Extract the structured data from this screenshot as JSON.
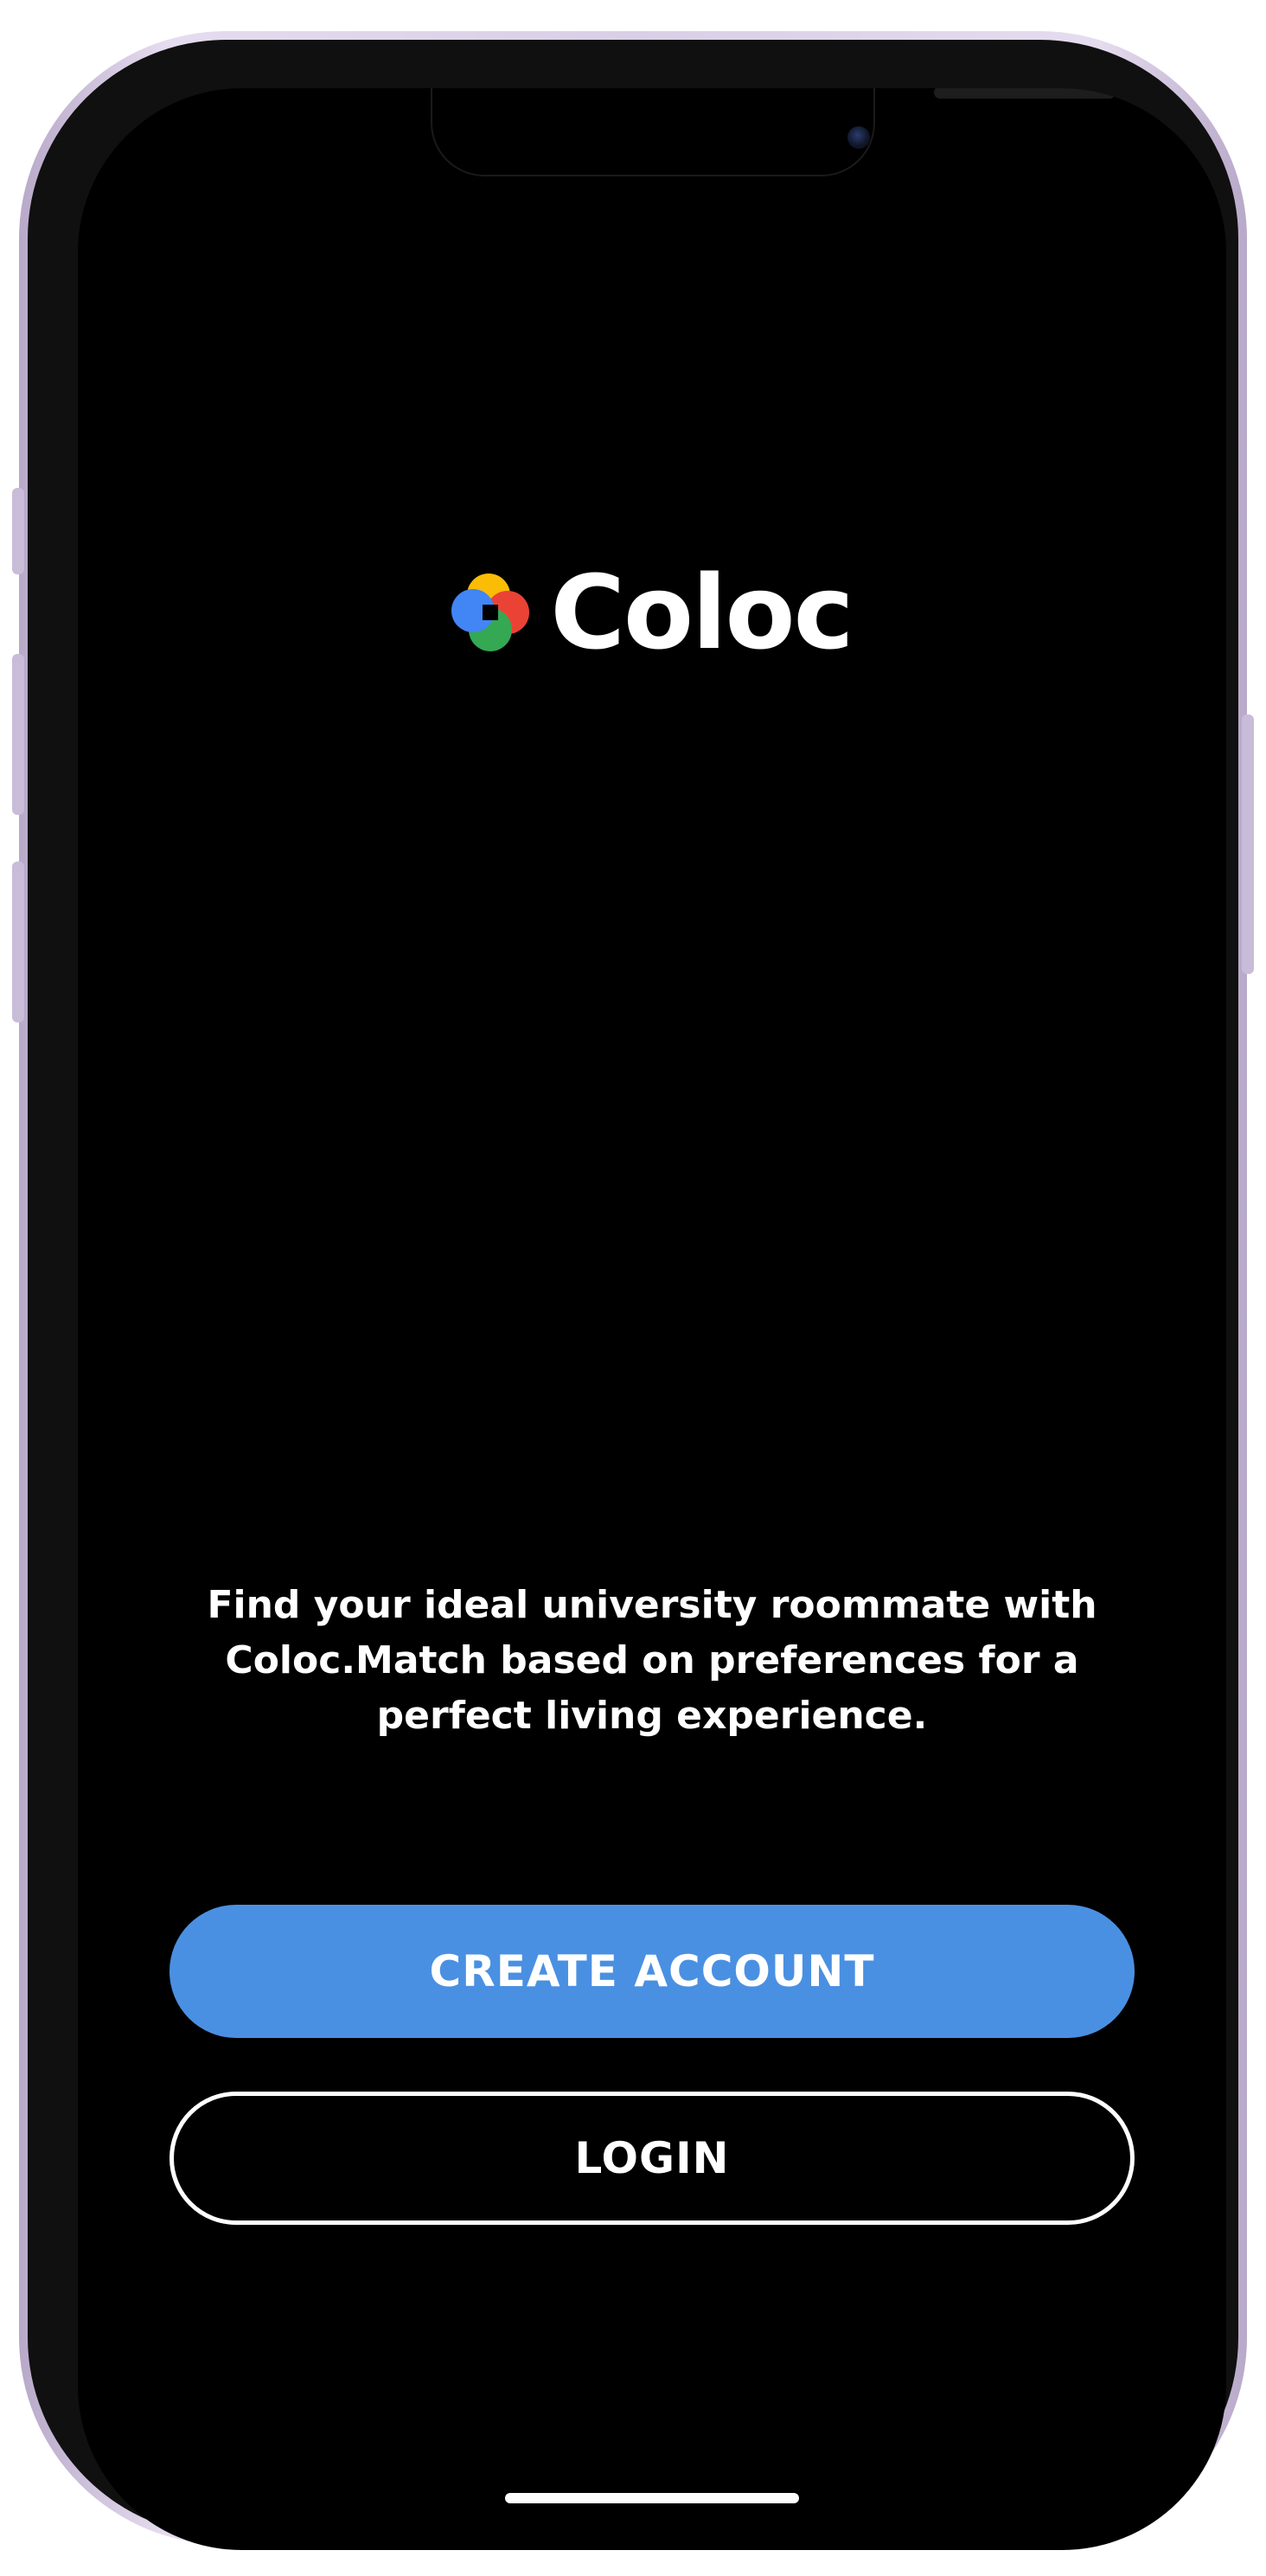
{
  "app": {
    "name": "Coloc",
    "logo_icon": "coloc-logo-icon",
    "logo_colors": [
      "#fbbc05",
      "#ea4335",
      "#34a853",
      "#4285f4"
    ]
  },
  "tagline": "Find your ideal university roommate with Coloc.Match based on preferences for a perfect living experience.",
  "buttons": {
    "create_account": "CREATE ACCOUNT",
    "login": "LOGIN"
  },
  "colors": {
    "primary": "#4a90e2",
    "background": "#000000",
    "text": "#ffffff"
  }
}
